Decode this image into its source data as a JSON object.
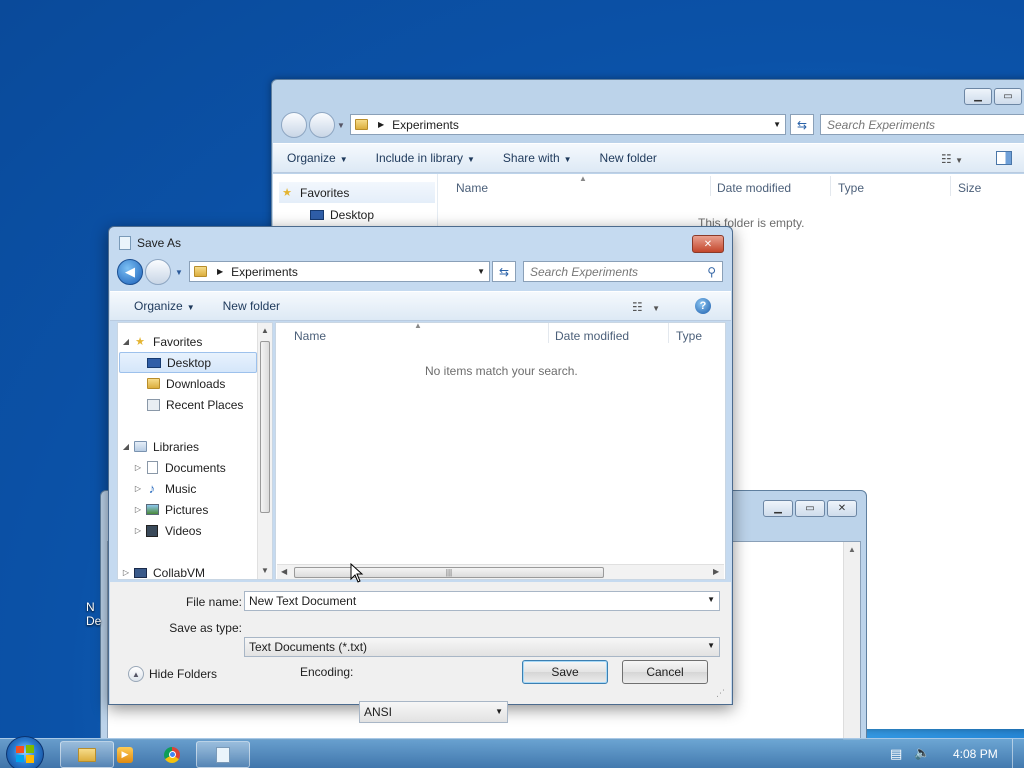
{
  "background_window": {
    "breadcrumb": "Experiments",
    "search_placeholder": "Search Experiments",
    "toolbar": {
      "organize": "Organize",
      "include_in_library": "Include in library",
      "share_with": "Share with",
      "new_folder": "New folder"
    },
    "columns": {
      "name": "Name",
      "date_modified": "Date modified",
      "type": "Type",
      "size": "Size"
    },
    "empty_message": "This folder is empty.",
    "nav": {
      "favorites": "Favorites",
      "desktop": "Desktop"
    }
  },
  "dialog": {
    "title": "Save As",
    "breadcrumb": "Experiments",
    "search_placeholder": "Search Experiments",
    "toolbar": {
      "organize": "Organize",
      "new_folder": "New folder"
    },
    "columns": {
      "name": "Name",
      "date_modified": "Date modified",
      "type": "Type"
    },
    "empty_message": "No items match your search.",
    "tree": {
      "favorites": "Favorites",
      "desktop": "Desktop",
      "downloads": "Downloads",
      "recent_places": "Recent Places",
      "libraries": "Libraries",
      "documents": "Documents",
      "music": "Music",
      "pictures": "Pictures",
      "videos": "Videos",
      "collabvm": "CollabVM"
    },
    "file_name_label": "File name:",
    "file_name_value": "New Text Document",
    "save_as_type_label": "Save as type:",
    "save_as_type_value": "Text Documents (*.txt)",
    "hide_folders": "Hide Folders",
    "encoding_label": "Encoding:",
    "encoding_value": "ANSI",
    "save_button": "Save",
    "cancel_button": "Cancel"
  },
  "taskbar": {
    "clock": "4:08 PM",
    "colors": {
      "accent": "#1370c6"
    }
  }
}
